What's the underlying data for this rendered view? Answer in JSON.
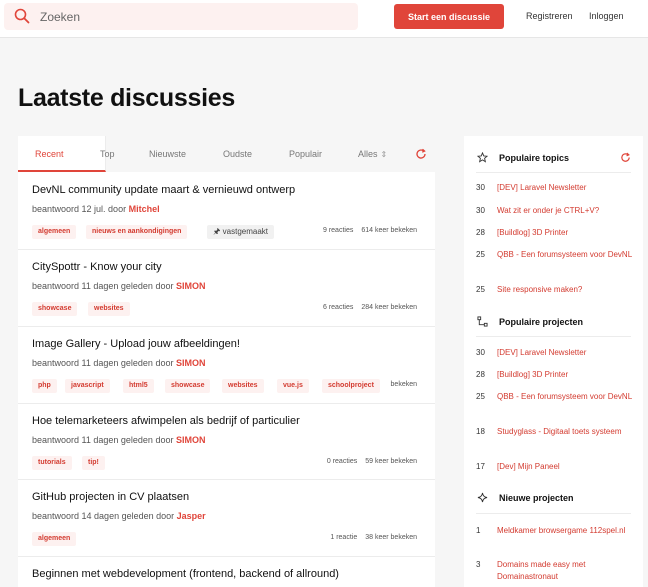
{
  "header": {
    "search_placeholder": "Zoeken",
    "start_discussion": "Start een discussie",
    "register": "Registreren",
    "login": "Inloggen"
  },
  "page_title": "Laatste discussies",
  "tabs": [
    "Recent",
    "Top",
    "Nieuwste",
    "Oudste",
    "Populair",
    "Alles"
  ],
  "threads": [
    {
      "title": "DevNL community update maart & vernieuwd ontwerp",
      "meta": "beantwoord 12 jul. door",
      "author": "Mitchel",
      "tags": [
        "algemeen",
        "nieuws en aankondigingen",
        "vastgemaakt"
      ],
      "replies": "9 reacties",
      "views": "614 keer bekeken"
    },
    {
      "title": "CitySpottr - Know your city",
      "meta": "beantwoord 11 dagen geleden door",
      "author": "SIMON",
      "tags": [
        "showcase",
        "websites"
      ],
      "replies": "6 reacties",
      "views": "284 keer bekeken"
    },
    {
      "title": "Image Gallery - Upload jouw afbeeldingen!",
      "meta": "beantwoord 11 dagen geleden door",
      "author": "SIMON",
      "tags": [
        "php",
        "javascript",
        "html5",
        "showcase",
        "websites",
        "vue.js",
        "schoolproject"
      ],
      "replies": "",
      "views": "bekeken"
    },
    {
      "title": "Hoe telemarketeers afwimpelen als bedrijf of particulier",
      "meta": "beantwoord 11 dagen geleden door",
      "author": "SIMON",
      "tags": [
        "tutorials",
        "tip!"
      ],
      "replies": "0 reacties",
      "views": "59 keer bekeken"
    },
    {
      "title": "GitHub projecten in CV plaatsen",
      "meta": "beantwoord 14 dagen geleden door",
      "author": "Jasper",
      "tags": [
        "algemeen"
      ],
      "replies": "1 reactie",
      "views": "38 keer bekeken"
    },
    {
      "title": "Beginnen met webdevelopment (frontend, backend of allround)",
      "meta": "",
      "author": "",
      "tags": [],
      "replies": "",
      "views": ""
    }
  ],
  "sidebar": {
    "popular_topics": {
      "title": "Populaire topics",
      "items": [
        {
          "count": "30",
          "label": "[DEV] Laravel Newsletter"
        },
        {
          "count": "30",
          "label": "Wat zit er onder je CTRL+V?"
        },
        {
          "count": "28",
          "label": "[Buildlog] 3D Printer"
        },
        {
          "count": "25",
          "label": "QBB - Een forumsysteem voor DevNL"
        },
        {
          "count": "25",
          "label": "Site responsive maken?"
        }
      ]
    },
    "popular_projects": {
      "title": "Populaire projecten",
      "items": [
        {
          "count": "30",
          "label": "[DEV] Laravel Newsletter"
        },
        {
          "count": "28",
          "label": "[Buildlog] 3D Printer"
        },
        {
          "count": "25",
          "label": "QBB - Een forumsysteem voor DevNL"
        },
        {
          "count": "18",
          "label": "Studyglass - Digitaal toets systeem"
        },
        {
          "count": "17",
          "label": "[Dev] Mijn Paneel"
        }
      ]
    },
    "new_projects": {
      "title": "Nieuwe projecten",
      "items": [
        {
          "count": "1",
          "label": "Meldkamer browsergame 112spel.nl"
        },
        {
          "count": "3",
          "label": "Domains made easy met Domainastronaut"
        }
      ]
    }
  },
  "colors": {
    "accent": "#e0453a",
    "tag_bg": "#fdf1f0"
  }
}
